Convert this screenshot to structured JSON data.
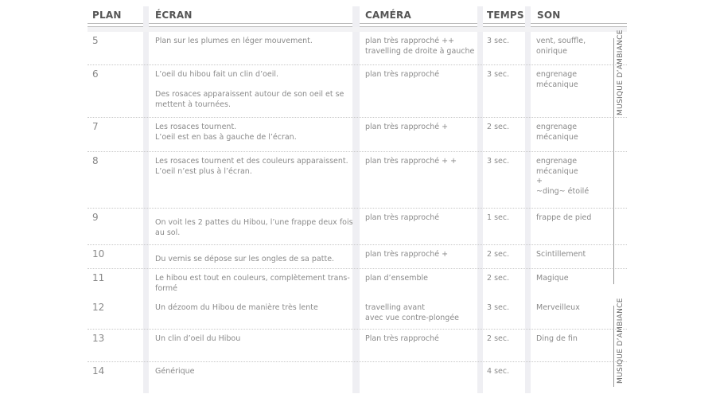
{
  "headers": {
    "plan": "PLAN",
    "ecran": "ÉCRAN",
    "camera": "CAMÉRA",
    "temps": "TEMPS",
    "son": "SON"
  },
  "rows": [
    {
      "plan": "5",
      "ecran": "Plan sur les plumes en léger mouvement.",
      "camera": "plan très rapproché ++\ntravelling de droite à gauche",
      "temps": "3 sec.",
      "son": "vent, souffle,\nonirique"
    },
    {
      "plan": "6",
      "ecran": "L’oeil du hibou fait un clin d’oeil.\n\nDes rosaces apparaissent autour de son oeil et se mettent à tournées.",
      "camera": "plan très rapproché",
      "temps": "3 sec.",
      "son": "engrenage\nmécanique"
    },
    {
      "plan": "7",
      "ecran": "Les rosaces tournent.\nL’oeil est en bas à gauche de l’écran.",
      "camera": "plan très rapproché +",
      "temps": "2 sec.",
      "son": "engrenage\nmécanique"
    },
    {
      "plan": "8",
      "ecran": "Les rosaces tournent et des couleurs apparaissent.\nL’oeil n’est plus à l’écran.",
      "camera": "plan très rapproché + +",
      "temps": "3 sec.",
      "son": "engrenage\nmécanique\n+\n~ding~ étoilé"
    },
    {
      "plan": "9",
      "ecran": "On voit les 2 pattes du Hibou, l’une frappe deux fois au sol.",
      "camera": "plan très rapproché",
      "temps": "1 sec.",
      "son": "frappe de pied"
    },
    {
      "plan": "10",
      "ecran": "Du vernis se dépose sur les ongles de sa patte.",
      "camera": "plan très rapproché +",
      "temps": "2 sec.",
      "son": "Scintillement"
    },
    {
      "plan": "11",
      "ecran": "Le hibou est tout en couleurs, complètement trans-\nformé",
      "camera": "plan d’ensemble",
      "temps": "2 sec.",
      "son": "Magique"
    },
    {
      "plan": "12",
      "ecran": "Un dézoom du Hibou de manière très lente",
      "camera": "travelling avant\navec vue contre-plongée",
      "temps": "3 sec.",
      "son": "Merveilleux"
    },
    {
      "plan": "13",
      "ecran": "Un clin d’oeil du Hibou",
      "camera": "Plan très rapproché",
      "temps": "2 sec.",
      "son": "Ding de fin"
    },
    {
      "plan": "14",
      "ecran": "Générique",
      "camera": "",
      "temps": "4 sec.",
      "son": ""
    }
  ],
  "music_labels": [
    "MUSIQUE D’AMBIANCE",
    "MUSIQUE D’AMBIANCE"
  ]
}
